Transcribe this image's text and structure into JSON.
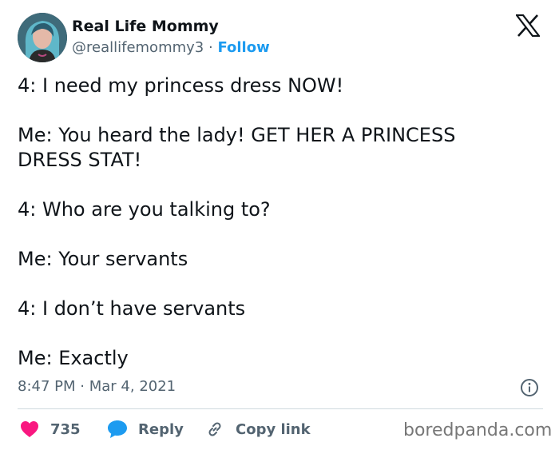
{
  "author": {
    "name": "Real Life Mommy",
    "handle": "@reallifemommy3",
    "separator": "·",
    "follow_label": "Follow"
  },
  "body_lines": [
    "4: I need my princess dress NOW!",
    "Me: You heard the lady! GET HER A PRINCESS\nDRESS STAT!",
    "4: Who are you talking to?",
    "Me: Your servants",
    "4: I don’t have servants",
    "Me: Exactly"
  ],
  "timestamp": {
    "time": "8:47 PM",
    "separator": "·",
    "date": "Mar 4, 2021"
  },
  "actions": {
    "likes_count": "735",
    "reply_label": "Reply",
    "copy_link_label": "Copy link"
  },
  "watermark": "boredpanda.com",
  "colors": {
    "like": "#f91880",
    "reply": "#1d9bf0",
    "follow": "#1d9bf0",
    "secondary_text": "#536471"
  },
  "icons": [
    "x-logo-icon",
    "info-icon",
    "heart-icon",
    "reply-bubble-icon",
    "link-icon"
  ]
}
